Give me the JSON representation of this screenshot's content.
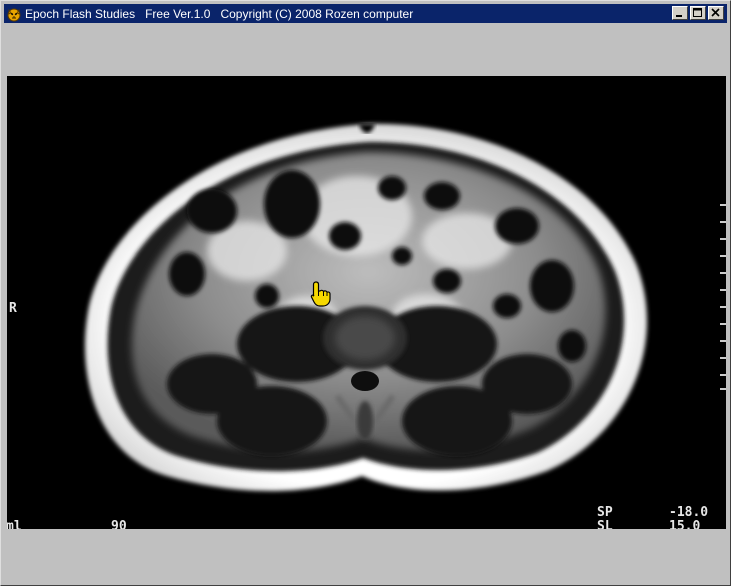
{
  "window": {
    "title": "Epoch Flash Studies   Free Ver.1.0   Copyright (C) 2008 Rozen computer",
    "icon": "tiger-app-icon",
    "buttons": {
      "minimize": "minimize-icon",
      "maximize": "maximize-icon",
      "close": "close-icon"
    }
  },
  "viewer": {
    "image": "axial abdominal MRI slice",
    "overlays": {
      "orientation": "R",
      "bottom_left": "ml",
      "bottom_mid": "90",
      "sp_label": "SP",
      "sp_value": "-18.0",
      "sl_label": "SL",
      "sl_value": "15.0"
    },
    "cursor": "pointing-hand-cursor-icon"
  },
  "colors": {
    "titlebar": "#0a246a",
    "window_bg": "#c0c0c0",
    "viewer_bg": "#000000",
    "cursor_fill": "#f5d800"
  }
}
